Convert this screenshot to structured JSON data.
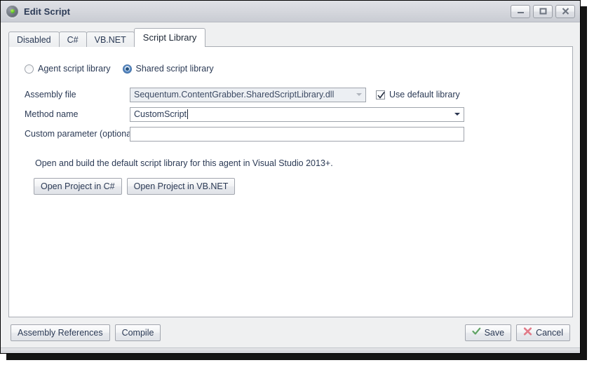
{
  "window": {
    "title": "Edit Script",
    "icon": "app-circle-icon",
    "controls": [
      {
        "name": "minimize",
        "glyph": "minimize-icon"
      },
      {
        "name": "maximize",
        "glyph": "maximize-icon"
      },
      {
        "name": "close",
        "glyph": "close-icon"
      }
    ]
  },
  "tabs": [
    {
      "label": "Disabled",
      "active": false
    },
    {
      "label": "C#",
      "active": false
    },
    {
      "label": "VB.NET",
      "active": false
    },
    {
      "label": "Script Library",
      "active": true
    }
  ],
  "library_scope": {
    "options": [
      {
        "label": "Agent script library",
        "selected": false
      },
      {
        "label": "Shared script library",
        "selected": true
      }
    ]
  },
  "form": {
    "assembly_file": {
      "label": "Assembly file",
      "value": "Sequentum.ContentGrabber.SharedScriptLibrary.dll",
      "enabled": false
    },
    "use_default_library": {
      "label": "Use default library",
      "checked": true
    },
    "method_name": {
      "label": "Method name",
      "value": "CustomScript",
      "enabled": true
    },
    "custom_parameter": {
      "label": "Custom parameter (optional)",
      "value": "",
      "placeholder": ""
    }
  },
  "description": "Open and build the default script library for this agent in Visual Studio 2013+.",
  "project_buttons": [
    {
      "label": "Open Project in C#"
    },
    {
      "label": "Open Project in VB.NET"
    }
  ],
  "footer": {
    "assembly_references_label": "Assembly References",
    "compile_label": "Compile",
    "save_label": "Save",
    "cancel_label": "Cancel"
  },
  "colors": {
    "accent_blue": "#36639c",
    "save_green": "#5fa364",
    "cancel_red": "#e27a88",
    "text": "#2b3a55",
    "window_bg": "#eff0f1",
    "panel_bg": "#ffffff"
  }
}
